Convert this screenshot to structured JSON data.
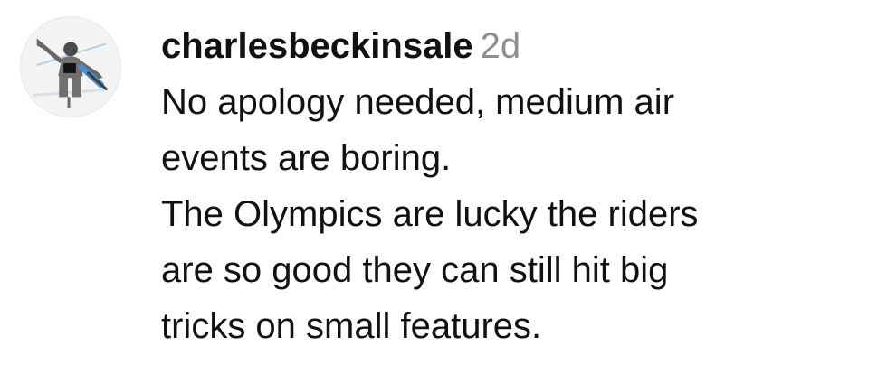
{
  "comment": {
    "username": "charlesbeckinsale",
    "timestamp": "2d",
    "lines": [
      "No apology needed, medium air",
      "events are boring.",
      "The Olympics are lucky the riders",
      "are so good they can still hit big",
      "tricks on small features."
    ]
  },
  "colors": {
    "username": "#111111",
    "timestamp": "#8e8e8e",
    "text": "#111111",
    "avatar_bg": "#f3f3f3"
  }
}
